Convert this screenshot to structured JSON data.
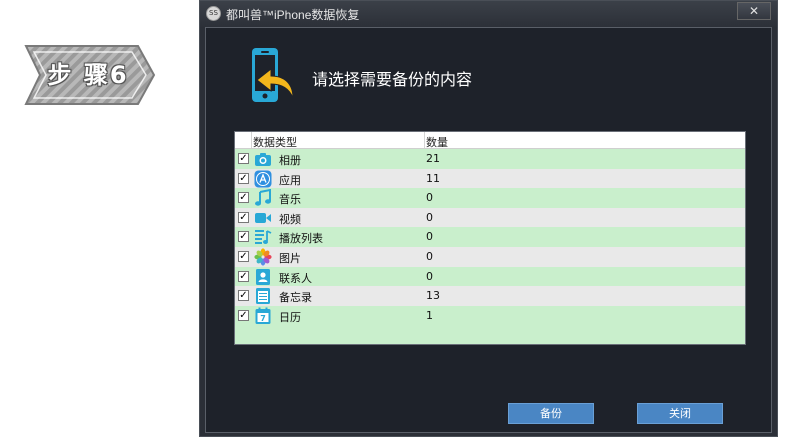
{
  "step_badge": {
    "label": "步 骤6"
  },
  "window": {
    "title": "都叫兽™iPhone数据恢复",
    "close_glyph": "✕",
    "app_icon_text": "SS"
  },
  "main": {
    "heading": "请选择需要备份的内容",
    "table": {
      "col_type": "数据类型",
      "col_count": "数量",
      "rows": [
        {
          "name": "相册",
          "count": "21",
          "checked": "✓",
          "icon": "camera-icon"
        },
        {
          "name": "应用",
          "count": "11",
          "checked": "✓",
          "icon": "app-store-icon"
        },
        {
          "name": "音乐",
          "count": "0",
          "checked": "✓",
          "icon": "music-note-icon"
        },
        {
          "name": "视频",
          "count": "0",
          "checked": "✓",
          "icon": "video-camera-icon"
        },
        {
          "name": "播放列表",
          "count": "0",
          "checked": "✓",
          "icon": "playlist-icon"
        },
        {
          "name": "图片",
          "count": "0",
          "checked": "✓",
          "icon": "photos-flower-icon"
        },
        {
          "name": "联系人",
          "count": "0",
          "checked": "✓",
          "icon": "contacts-icon"
        },
        {
          "name": "备忘录",
          "count": "13",
          "checked": "✓",
          "icon": "notes-icon"
        },
        {
          "name": "日历",
          "count": "1",
          "checked": "✓",
          "icon": "calendar-icon"
        }
      ]
    },
    "calendar_day": "7",
    "buttons": {
      "backup": "备份",
      "close": "关闭"
    }
  },
  "colors": {
    "window_bg": "#2b2f37",
    "content_bg": "#1e222a",
    "row_green": "#c9efcc",
    "row_gray": "#e9e9e9",
    "button_blue": "#4a86c4",
    "icon_cyan": "#29a8d6",
    "arrow_yellow": "#f2b61c"
  }
}
